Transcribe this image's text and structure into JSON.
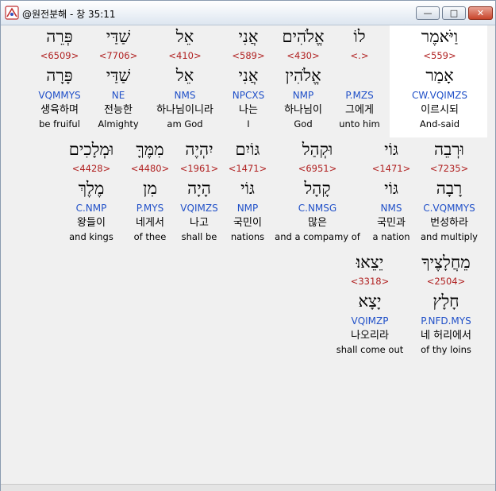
{
  "window": {
    "title": "@원전분해 - 창 35:11",
    "buttons": {
      "minimize": "—",
      "maximize": "□",
      "close": "✕"
    },
    "app_icon": "mini-app-icon"
  },
  "words": [
    {
      "heb1": "וַיֹּאמֶר",
      "strong": "<559>",
      "heb2": "אָמַר",
      "parse": "CW.VQIMZS",
      "kor": "이르시되",
      "eng": "And-said"
    },
    {
      "heb1": "לוֹ",
      "strong": "<.>",
      "heb2": "",
      "parse": "P.MZS",
      "kor": "그에게",
      "eng": "unto him"
    },
    {
      "heb1": "אֱלֹהִים",
      "strong": "<430>",
      "heb2": "אֱלֹהִין",
      "parse": "NMP",
      "kor": "하나님이",
      "eng": "God"
    },
    {
      "heb1": "אֲנִי",
      "strong": "<589>",
      "heb2": "אֲנִי",
      "parse": "NPCXS",
      "kor": "나는",
      "eng": "I"
    },
    {
      "heb1": "אֵל",
      "strong": "<410>",
      "heb2": "אֵל",
      "parse": "NMS",
      "kor": "하나님이니라",
      "eng": "am God"
    },
    {
      "heb1": "שַׁדַּי",
      "strong": "<7706>",
      "heb2": "שַׁדַּי",
      "parse": "NE",
      "kor": "전능한",
      "eng": "Almighty"
    },
    {
      "heb1": "פְּרֵה",
      "strong": "<6509>",
      "heb2": "פָּרָה",
      "parse": "VQMMYS",
      "kor": "생육하며",
      "eng": "be fruiful"
    },
    {
      "heb1": "וּרְבֵה",
      "strong": "<7235>",
      "heb2": "רָבָה",
      "parse": "C.VQMMYS",
      "kor": "번성하라",
      "eng": "and multiply"
    },
    {
      "heb1": "גּוֹי",
      "strong": "<1471>",
      "heb2": "גּוֹי",
      "parse": "NMS",
      "kor": "국민과",
      "eng": "a nation"
    },
    {
      "heb1": "וּקְהַל",
      "strong": "<6951>",
      "heb2": "קָהָל",
      "parse": "C.NMSG",
      "kor": "많은",
      "eng": "and a compamy of"
    },
    {
      "heb1": "גּוֹיִם",
      "strong": "<1471>",
      "heb2": "גּוֹי",
      "parse": "NMP",
      "kor": "국민이",
      "eng": "nations"
    },
    {
      "heb1": "יִהְיֶה",
      "strong": "<1961>",
      "heb2": "הָיָה",
      "parse": "VQIMZS",
      "kor": "나고",
      "eng": "shall be"
    },
    {
      "heb1": "מִמֶּךָּ",
      "strong": "<4480>",
      "heb2": "מִן",
      "parse": "P.MYS",
      "kor": "네게서",
      "eng": "of thee"
    },
    {
      "heb1": "וּמְלָכִים",
      "strong": "<4428>",
      "heb2": "מֶלֶךְ",
      "parse": "C.NMP",
      "kor": "왕들이",
      "eng": "and kings"
    },
    {
      "heb1": "מֵחֲלָצֶיךָ",
      "strong": "<2504>",
      "heb2": "חָלָץ",
      "parse": "P.NFD.MYS",
      "kor": "네 허리에서",
      "eng": "of thy loins"
    },
    {
      "heb1": "יֵצֵאוּ׃",
      "strong": "<3318>",
      "heb2": "יָצָא",
      "parse": "VQIMZP",
      "kor": "나오리라",
      "eng": "shall come out"
    }
  ]
}
